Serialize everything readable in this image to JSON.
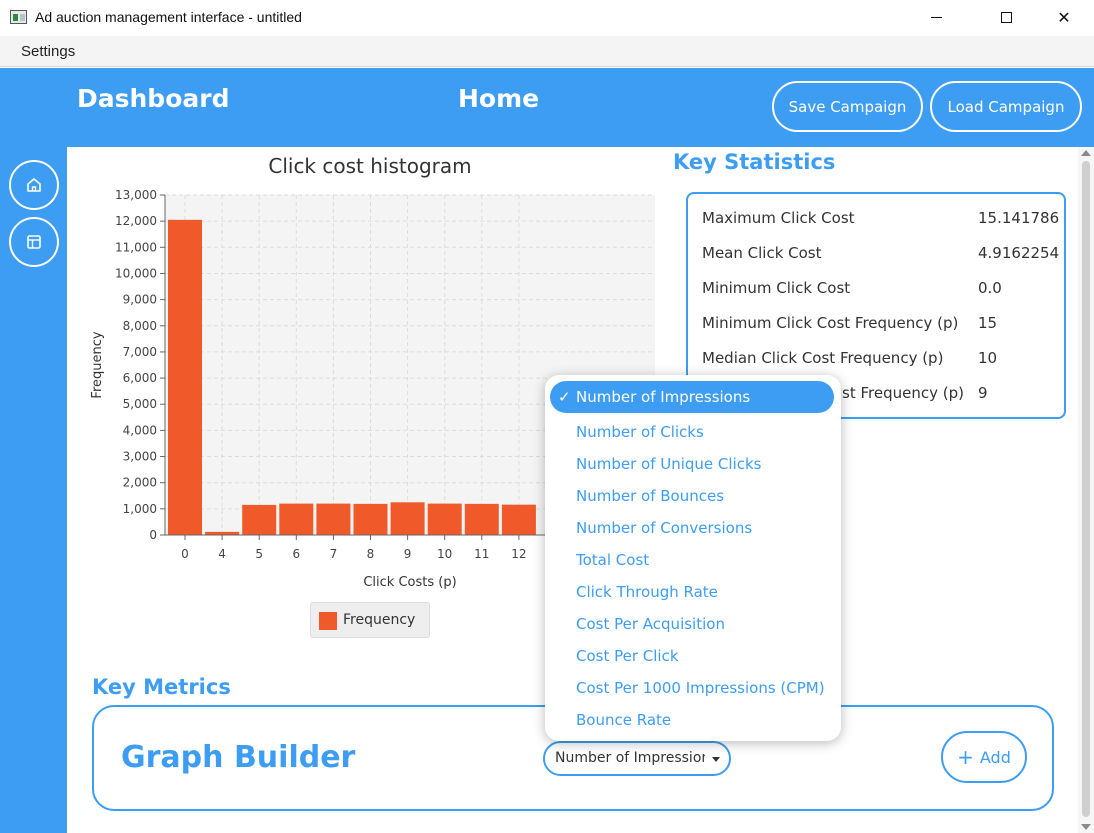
{
  "window": {
    "title": "Ad auction management interface - untitled",
    "minimize_icon": "minimize-icon",
    "maximize_icon": "maximize-icon",
    "close_icon": "close-icon",
    "close_glyph": "✕"
  },
  "menu": {
    "items": [
      "Settings"
    ]
  },
  "header": {
    "dashboard_title": "Dashboard",
    "home_title": "Home",
    "save_button": "Save Campaign",
    "load_button": "Load Campaign",
    "accent": "#3d9df2"
  },
  "sidebar": {
    "icons": [
      "home-icon",
      "layout-icon"
    ]
  },
  "chart_data": {
    "type": "bar",
    "title": "Click cost histogram",
    "xlabel": "Click Costs (p)",
    "ylabel": "Frequency",
    "ylim": [
      0,
      13000
    ],
    "yticks": [
      0,
      1000,
      2000,
      3000,
      4000,
      5000,
      6000,
      7000,
      8000,
      9000,
      10000,
      11000,
      12000,
      13000
    ],
    "ytick_labels": [
      "0",
      "1,000",
      "2,000",
      "3,000",
      "4,000",
      "5,000",
      "6,000",
      "7,000",
      "8,000",
      "9,000",
      "10,000",
      "11,000",
      "12,000",
      "13,000"
    ],
    "categories": [
      "0",
      "4",
      "5",
      "6",
      "7",
      "8",
      "9",
      "10",
      "11",
      "12"
    ],
    "series": [
      {
        "name": "Frequency",
        "values": [
          12050,
          120,
          1150,
          1200,
          1200,
          1190,
          1250,
          1200,
          1190,
          1160
        ],
        "color": "#f05a2a"
      }
    ],
    "grid": true,
    "legend": "bottom"
  },
  "key_statistics": {
    "title": "Key Statistics",
    "rows": [
      {
        "label": "Maximum Click Cost",
        "value": "15.141786"
      },
      {
        "label": "Mean Click Cost",
        "value": "4.9162254"
      },
      {
        "label": "Minimum Click Cost",
        "value": "0.0"
      },
      {
        "label": "Minimum Click Cost Frequency (p)",
        "value": "15"
      },
      {
        "label": "Median Click Cost Frequency (p)",
        "value": "10"
      },
      {
        "label": "st Frequency (p)",
        "value": "9"
      }
    ]
  },
  "key_metrics": {
    "title": "Key Metrics",
    "graph_builder_title": "Graph Builder",
    "selected_metric": "Number of Impressions",
    "add_label": "Add"
  },
  "dropdown": {
    "check_glyph": "✓",
    "options": [
      "Number of Impressions",
      "Number of Clicks",
      "Number of Unique Clicks",
      "Number of Bounces",
      "Number of Conversions",
      "Total Cost",
      "Click Through Rate",
      "Cost Per Acquisition",
      "Cost Per Click",
      "Cost Per 1000 Impressions (CPM)",
      "Bounce Rate"
    ],
    "selected_index": 0
  }
}
